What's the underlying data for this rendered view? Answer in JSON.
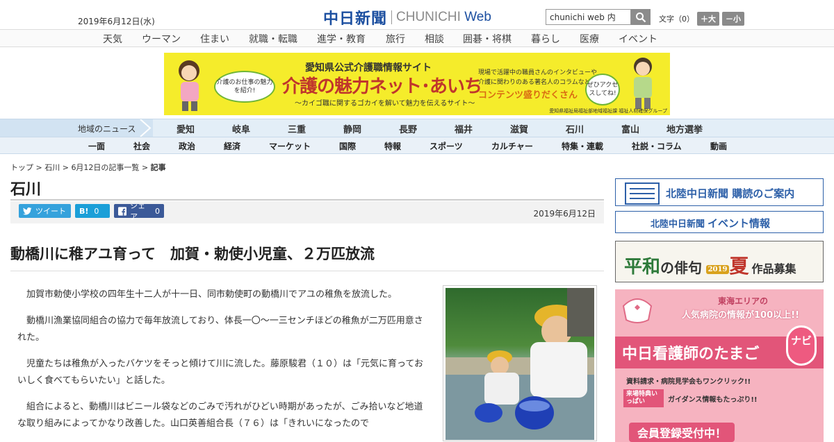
{
  "header": {
    "date": "2019年6月12日(水)",
    "logo_jp": "中日新聞",
    "logo_en_prefix": "CHUNICHI ",
    "logo_en_suffix": "Web",
    "search_value": "chunichi web 内",
    "font_label": "文字（0）",
    "font_large": "＋大",
    "font_small": "－小"
  },
  "category_nav": [
    "天気",
    "ウーマン",
    "住まい",
    "就職・転職",
    "進学・教育",
    "旅行",
    "相談",
    "囲碁・将棋",
    "暮らし",
    "医療",
    "イベント"
  ],
  "banner": {
    "top": "愛知県公式介護職情報サイト",
    "main": "介護の魅力ネット･あいち",
    "sub": "～カイゴ職に関するゴカイを解いて魅力を伝えるサイト～",
    "bubble_left": "介護のお仕事の魅力を紹介!",
    "right_line1": "現場で活躍中の職員さんのインタビューや",
    "right_line2": "介護に関わりのある著名人のコラムなど",
    "right_strong": "コンテンツ盛りだくさん",
    "bubble_right": "ぜひアクセスしてね!",
    "footer": "愛知県福祉局福祉部地域福祉課 福祉人材確保グループ"
  },
  "region_nav": {
    "label": "地域のニュース",
    "items": [
      "愛知",
      "岐阜",
      "三重",
      "静岡",
      "長野",
      "福井",
      "滋賀",
      "石川",
      "富山",
      "地方選挙"
    ]
  },
  "main_nav": [
    "一面",
    "社会",
    "政治",
    "経済",
    "マーケット",
    "国際",
    "特報",
    "スポーツ",
    "カルチャー",
    "特集・連載",
    "社説・コラム",
    "動画"
  ],
  "breadcrumb": [
    "トップ",
    "石川",
    "6月12日の記事一覧",
    "記事"
  ],
  "breadcrumb_sep": ">",
  "section_title": "石川",
  "share": {
    "tweet": "ツイート",
    "hatena_label": "B!",
    "hatena_count": "0",
    "facebook": "シェア",
    "facebook_count": "0"
  },
  "article": {
    "date": "2019年6月12日",
    "headline": "動橋川に稚アユ育って　加賀・勅使小児童、２万匹放流",
    "paragraphs": [
      "加賀市勅使小学校の四年生十二人が十一日、同市勅使町の動橋川でアユの稚魚を放流した。",
      "動橋川漁業協同組合の協力で毎年放流しており、体長一〇～一三センチほどの稚魚が二万匹用意された。",
      "児童たちは稚魚が入ったバケツをそっと傾けて川に流した。藤原駿君（１０）は「元気に育っておいしく食べてもらいたい」と話した。",
      "組合によると、動橋川はビニール袋などのごみで汚れがひどい時期があったが、ごみ拾いなど地道な取り組みによってかなり改善した。山口英善組合長（７６）は「きれいになったので"
    ]
  },
  "sidebar": {
    "box1": "北陸中日新聞 購読のご案内",
    "box2_a": "北陸中日新聞",
    "box2_b": "イベント情報",
    "box3_a": "平和",
    "box3_b": "の俳句",
    "box3_year": "2019",
    "box3_c": "夏",
    "box3_d": "作品募集",
    "box4_top1": "東海エリアの",
    "box4_top2": "人気病院の情報が100以上!!",
    "box4_main": "中日看護師のたまご",
    "box4_navi": "ナビ",
    "box4_line1": "資料請求・病院見学会もワンクリック!!",
    "box4_badge": "来場特典いっぱい",
    "box4_line2": "ガイダンス情報もたっぷり!!",
    "box4_bottom": "会員登録受付中！"
  },
  "colors": {
    "brand_blue": "#1c4fa0",
    "banner_yellow": "#f5ec2b",
    "twitter": "#35a2dc",
    "hatena": "#1b9fd8",
    "facebook": "#3b5998"
  }
}
